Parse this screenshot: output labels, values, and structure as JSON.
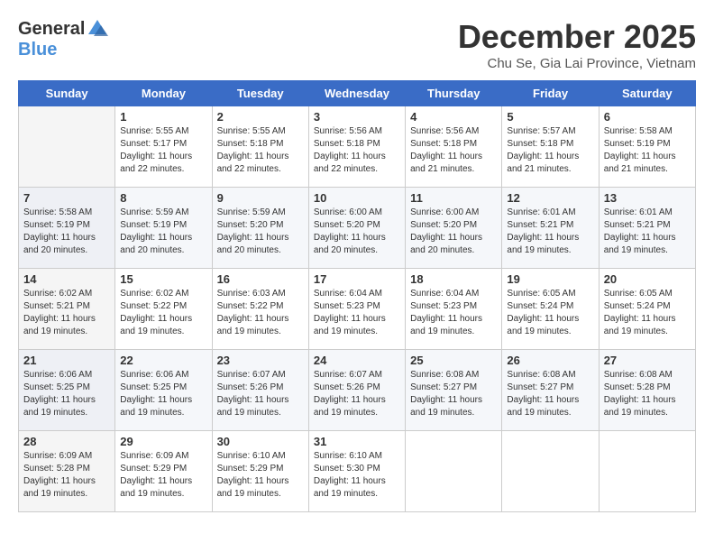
{
  "header": {
    "logo_general": "General",
    "logo_blue": "Blue",
    "month_title": "December 2025",
    "location": "Chu Se, Gia Lai Province, Vietnam"
  },
  "days_of_week": [
    "Sunday",
    "Monday",
    "Tuesday",
    "Wednesday",
    "Thursday",
    "Friday",
    "Saturday"
  ],
  "weeks": [
    [
      {
        "day": "",
        "sunrise": "",
        "sunset": "",
        "daylight": ""
      },
      {
        "day": "1",
        "sunrise": "Sunrise: 5:55 AM",
        "sunset": "Sunset: 5:17 PM",
        "daylight": "Daylight: 11 hours and 22 minutes."
      },
      {
        "day": "2",
        "sunrise": "Sunrise: 5:55 AM",
        "sunset": "Sunset: 5:18 PM",
        "daylight": "Daylight: 11 hours and 22 minutes."
      },
      {
        "day": "3",
        "sunrise": "Sunrise: 5:56 AM",
        "sunset": "Sunset: 5:18 PM",
        "daylight": "Daylight: 11 hours and 22 minutes."
      },
      {
        "day": "4",
        "sunrise": "Sunrise: 5:56 AM",
        "sunset": "Sunset: 5:18 PM",
        "daylight": "Daylight: 11 hours and 21 minutes."
      },
      {
        "day": "5",
        "sunrise": "Sunrise: 5:57 AM",
        "sunset": "Sunset: 5:18 PM",
        "daylight": "Daylight: 11 hours and 21 minutes."
      },
      {
        "day": "6",
        "sunrise": "Sunrise: 5:58 AM",
        "sunset": "Sunset: 5:19 PM",
        "daylight": "Daylight: 11 hours and 21 minutes."
      }
    ],
    [
      {
        "day": "7",
        "sunrise": "Sunrise: 5:58 AM",
        "sunset": "Sunset: 5:19 PM",
        "daylight": "Daylight: 11 hours and 20 minutes."
      },
      {
        "day": "8",
        "sunrise": "Sunrise: 5:59 AM",
        "sunset": "Sunset: 5:19 PM",
        "daylight": "Daylight: 11 hours and 20 minutes."
      },
      {
        "day": "9",
        "sunrise": "Sunrise: 5:59 AM",
        "sunset": "Sunset: 5:20 PM",
        "daylight": "Daylight: 11 hours and 20 minutes."
      },
      {
        "day": "10",
        "sunrise": "Sunrise: 6:00 AM",
        "sunset": "Sunset: 5:20 PM",
        "daylight": "Daylight: 11 hours and 20 minutes."
      },
      {
        "day": "11",
        "sunrise": "Sunrise: 6:00 AM",
        "sunset": "Sunset: 5:20 PM",
        "daylight": "Daylight: 11 hours and 20 minutes."
      },
      {
        "day": "12",
        "sunrise": "Sunrise: 6:01 AM",
        "sunset": "Sunset: 5:21 PM",
        "daylight": "Daylight: 11 hours and 19 minutes."
      },
      {
        "day": "13",
        "sunrise": "Sunrise: 6:01 AM",
        "sunset": "Sunset: 5:21 PM",
        "daylight": "Daylight: 11 hours and 19 minutes."
      }
    ],
    [
      {
        "day": "14",
        "sunrise": "Sunrise: 6:02 AM",
        "sunset": "Sunset: 5:21 PM",
        "daylight": "Daylight: 11 hours and 19 minutes."
      },
      {
        "day": "15",
        "sunrise": "Sunrise: 6:02 AM",
        "sunset": "Sunset: 5:22 PM",
        "daylight": "Daylight: 11 hours and 19 minutes."
      },
      {
        "day": "16",
        "sunrise": "Sunrise: 6:03 AM",
        "sunset": "Sunset: 5:22 PM",
        "daylight": "Daylight: 11 hours and 19 minutes."
      },
      {
        "day": "17",
        "sunrise": "Sunrise: 6:04 AM",
        "sunset": "Sunset: 5:23 PM",
        "daylight": "Daylight: 11 hours and 19 minutes."
      },
      {
        "day": "18",
        "sunrise": "Sunrise: 6:04 AM",
        "sunset": "Sunset: 5:23 PM",
        "daylight": "Daylight: 11 hours and 19 minutes."
      },
      {
        "day": "19",
        "sunrise": "Sunrise: 6:05 AM",
        "sunset": "Sunset: 5:24 PM",
        "daylight": "Daylight: 11 hours and 19 minutes."
      },
      {
        "day": "20",
        "sunrise": "Sunrise: 6:05 AM",
        "sunset": "Sunset: 5:24 PM",
        "daylight": "Daylight: 11 hours and 19 minutes."
      }
    ],
    [
      {
        "day": "21",
        "sunrise": "Sunrise: 6:06 AM",
        "sunset": "Sunset: 5:25 PM",
        "daylight": "Daylight: 11 hours and 19 minutes."
      },
      {
        "day": "22",
        "sunrise": "Sunrise: 6:06 AM",
        "sunset": "Sunset: 5:25 PM",
        "daylight": "Daylight: 11 hours and 19 minutes."
      },
      {
        "day": "23",
        "sunrise": "Sunrise: 6:07 AM",
        "sunset": "Sunset: 5:26 PM",
        "daylight": "Daylight: 11 hours and 19 minutes."
      },
      {
        "day": "24",
        "sunrise": "Sunrise: 6:07 AM",
        "sunset": "Sunset: 5:26 PM",
        "daylight": "Daylight: 11 hours and 19 minutes."
      },
      {
        "day": "25",
        "sunrise": "Sunrise: 6:08 AM",
        "sunset": "Sunset: 5:27 PM",
        "daylight": "Daylight: 11 hours and 19 minutes."
      },
      {
        "day": "26",
        "sunrise": "Sunrise: 6:08 AM",
        "sunset": "Sunset: 5:27 PM",
        "daylight": "Daylight: 11 hours and 19 minutes."
      },
      {
        "day": "27",
        "sunrise": "Sunrise: 6:08 AM",
        "sunset": "Sunset: 5:28 PM",
        "daylight": "Daylight: 11 hours and 19 minutes."
      }
    ],
    [
      {
        "day": "28",
        "sunrise": "Sunrise: 6:09 AM",
        "sunset": "Sunset: 5:28 PM",
        "daylight": "Daylight: 11 hours and 19 minutes."
      },
      {
        "day": "29",
        "sunrise": "Sunrise: 6:09 AM",
        "sunset": "Sunset: 5:29 PM",
        "daylight": "Daylight: 11 hours and 19 minutes."
      },
      {
        "day": "30",
        "sunrise": "Sunrise: 6:10 AM",
        "sunset": "Sunset: 5:29 PM",
        "daylight": "Daylight: 11 hours and 19 minutes."
      },
      {
        "day": "31",
        "sunrise": "Sunrise: 6:10 AM",
        "sunset": "Sunset: 5:30 PM",
        "daylight": "Daylight: 11 hours and 19 minutes."
      },
      {
        "day": "",
        "sunrise": "",
        "sunset": "",
        "daylight": ""
      },
      {
        "day": "",
        "sunrise": "",
        "sunset": "",
        "daylight": ""
      },
      {
        "day": "",
        "sunrise": "",
        "sunset": "",
        "daylight": ""
      }
    ]
  ]
}
